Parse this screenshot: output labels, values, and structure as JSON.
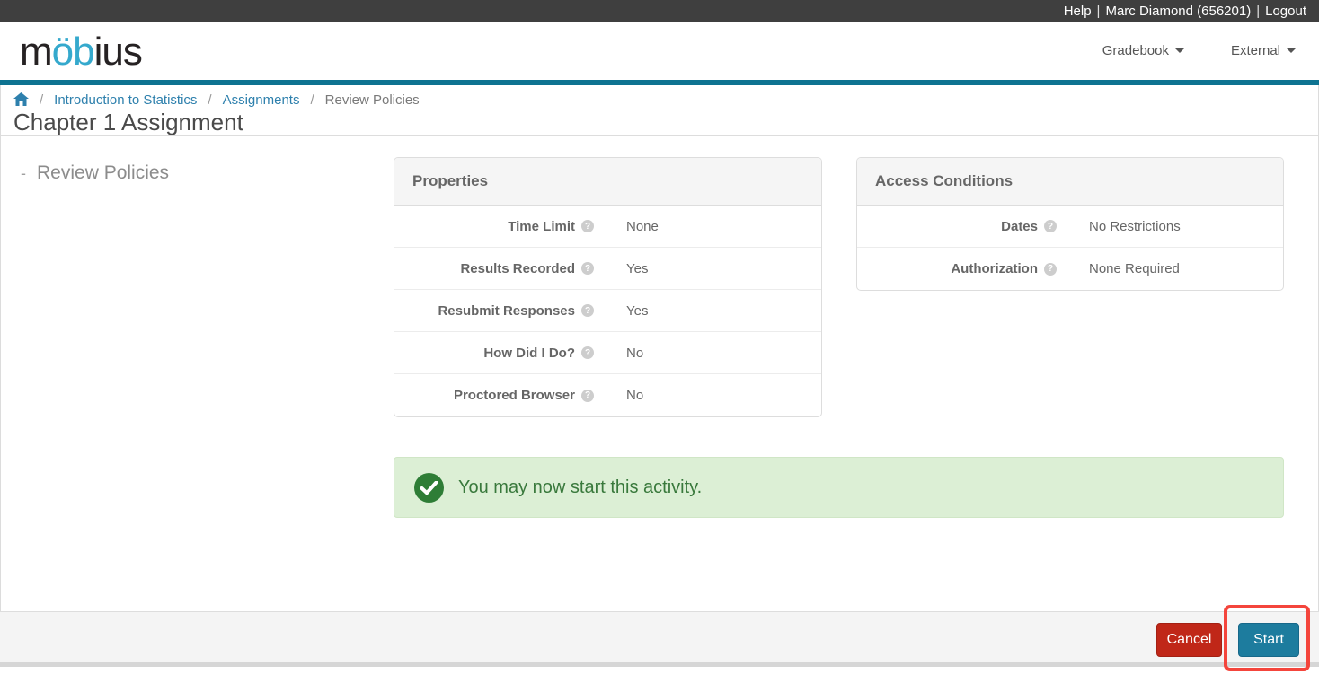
{
  "topbar": {
    "help_label": "Help",
    "separator": "|",
    "user_label": "Marc Diamond (656201)",
    "logout_label": "Logout"
  },
  "header": {
    "logo_part1": "m",
    "logo_part2": "öb",
    "logo_part3": "ius",
    "menus": [
      {
        "label": "Gradebook"
      },
      {
        "label": "External"
      }
    ]
  },
  "breadcrumb": {
    "separator": "/",
    "items": [
      {
        "label": "Introduction to Statistics"
      },
      {
        "label": "Assignments"
      },
      {
        "label": "Review Policies"
      }
    ]
  },
  "page": {
    "title": "Chapter 1 Assignment"
  },
  "sidebar": {
    "dash": "-",
    "item_label": "Review Policies"
  },
  "properties": {
    "title": "Properties",
    "rows": [
      {
        "label": "Time Limit",
        "value": "None"
      },
      {
        "label": "Results Recorded",
        "value": "Yes"
      },
      {
        "label": "Resubmit Responses",
        "value": "Yes"
      },
      {
        "label": "How Did I Do?",
        "value": "No"
      },
      {
        "label": "Proctored Browser",
        "value": "No"
      }
    ]
  },
  "access_conditions": {
    "title": "Access Conditions",
    "rows": [
      {
        "label": "Dates",
        "value": "No Restrictions"
      },
      {
        "label": "Authorization",
        "value": "None Required"
      }
    ]
  },
  "message": {
    "text": "You may now start this activity."
  },
  "footer": {
    "cancel_label": "Cancel",
    "start_label": "Start"
  },
  "colors": {
    "topbar_bg": "#3f3f3f",
    "brand_teal": "#0e7391",
    "logo_blue": "#35a9cd",
    "link_blue": "#2e80ad",
    "success_bg": "#dcefd5",
    "success_text": "#39793c",
    "success_icon": "#2e7d36",
    "cancel_red": "#c02718",
    "start_teal": "#1d7c9e",
    "annotation_red": "#f4453c"
  }
}
